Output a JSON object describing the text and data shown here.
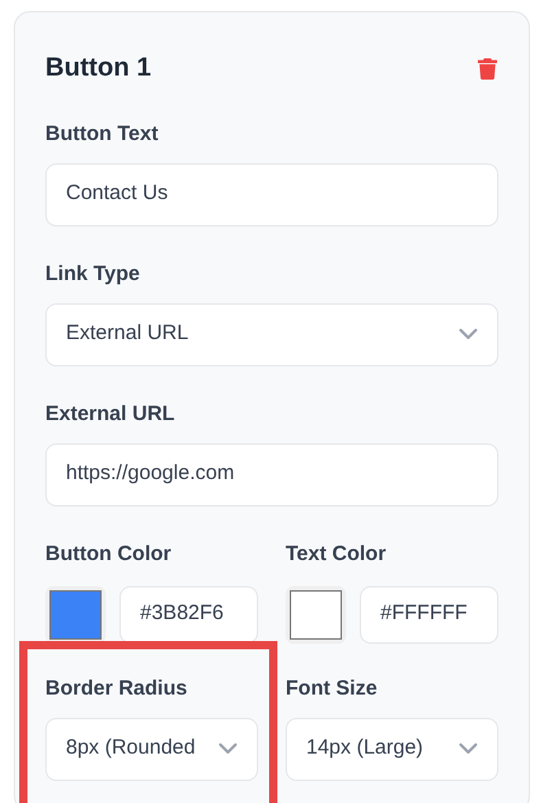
{
  "card": {
    "title": "Button 1"
  },
  "fields": [
    {
      "kind": "text",
      "label": "Button Text",
      "value": "Contact Us"
    },
    {
      "kind": "select",
      "label": "Link Type",
      "value": "External URL"
    },
    {
      "kind": "text",
      "label": "External URL",
      "value": "https://google.com"
    }
  ],
  "colors": [
    {
      "label": "Button Color",
      "color": "#3b82f6",
      "value": "#3B82F6"
    },
    {
      "label": "Text Color",
      "color": "#ffffff",
      "value": "#FFFFFF"
    }
  ],
  "selects": [
    {
      "label": "Border Radius",
      "value": "8px (Rounded",
      "highlighted": true
    },
    {
      "label": "Font Size",
      "value": "14px (Large)",
      "highlighted": false
    }
  ]
}
